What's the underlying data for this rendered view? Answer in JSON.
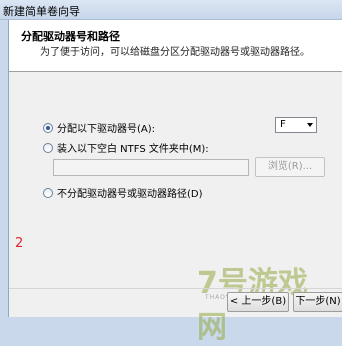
{
  "window": {
    "title": "新建简单卷向导"
  },
  "header": {
    "title": "分配驱动器号和路径",
    "subtitle": "为了便于访问，可以给磁盘分区分配驱动器号或驱动器路径。"
  },
  "options": {
    "assign_letter": {
      "label": "分配以下驱动器号(A):",
      "selected": true
    },
    "mount_folder": {
      "label": "装入以下空白 NTFS 文件夹中(M):",
      "selected": false
    },
    "no_assign": {
      "label": "不分配驱动器号或驱动器路径(D)",
      "selected": false
    }
  },
  "drive_letter": {
    "value": "F"
  },
  "folder_path": {
    "value": ""
  },
  "buttons": {
    "browse": "浏览(R)...",
    "back": "< 上一步(B)",
    "next": "下一步(N)"
  },
  "annotation": "2",
  "watermark": {
    "text": "7号游戏网",
    "sub": "THAOYOUXIWANG"
  }
}
